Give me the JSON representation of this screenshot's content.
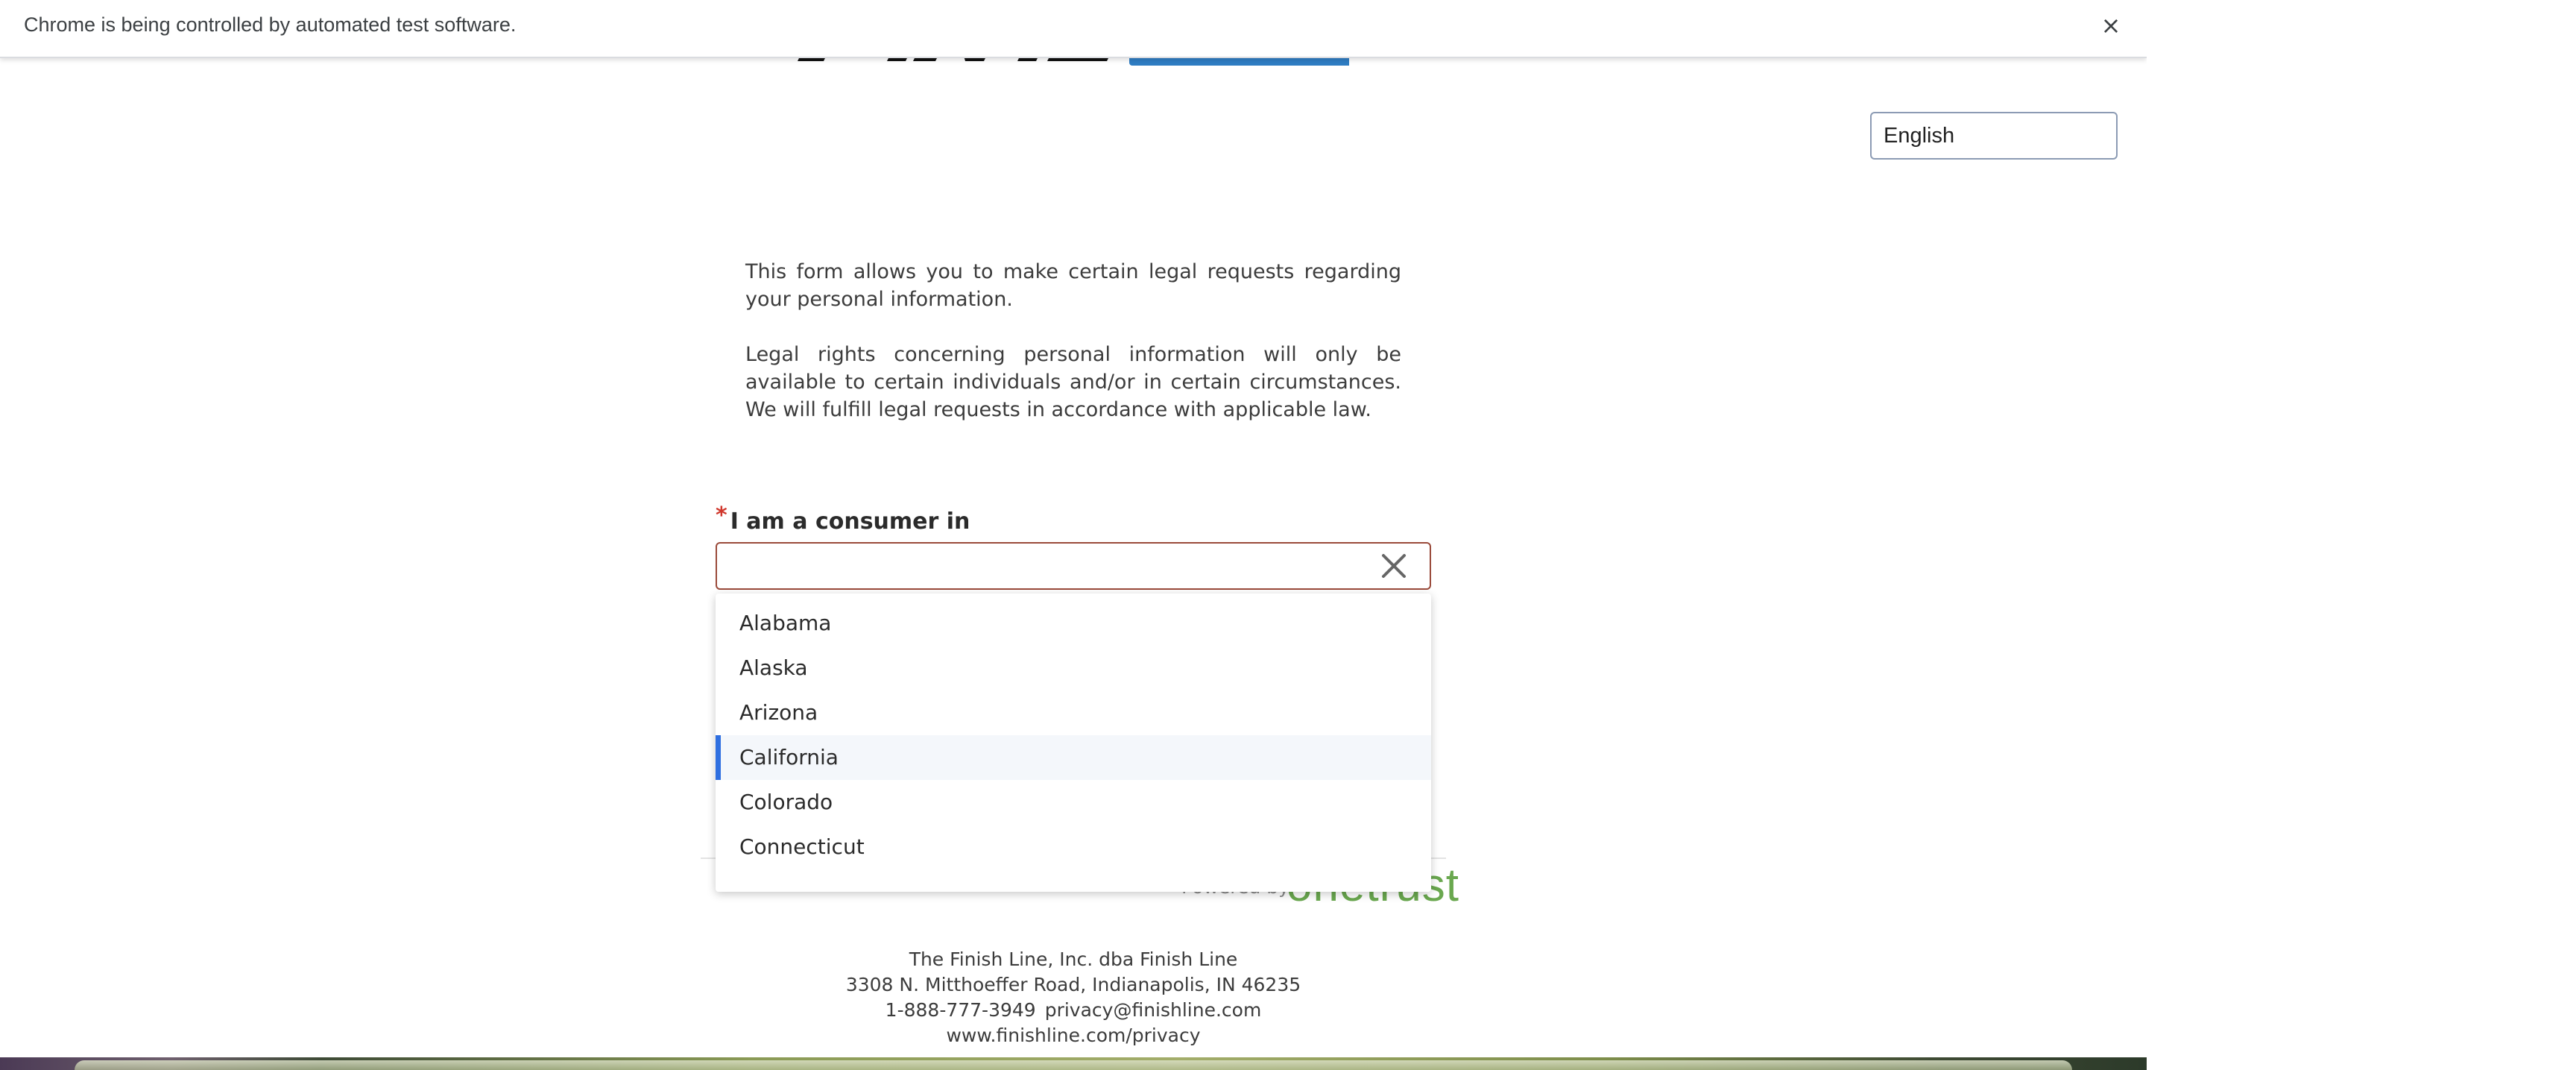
{
  "infobar": {
    "message": "Chrome is being controlled by automated test software.",
    "close_symbol": "×"
  },
  "colors": {
    "brand_blue": "#2f7dc3",
    "brand_black": "#111111",
    "onetrust_green": "#6aa84f",
    "required": "#d0372c",
    "active_indicator": "#2f6fe0"
  },
  "language": {
    "selected": "English"
  },
  "intro": {
    "paragraph_1": "This form allows you to make certain legal requests regarding your personal information.",
    "paragraph_2": "Legal rights concerning personal information will only be available to certain individuals and/or in certain circumstances. We will fulfill legal requests in accordance with applicable law."
  },
  "consumer_field": {
    "required_marker": "*",
    "label": "I am a consumer in",
    "value": "",
    "clear_icon": "close-icon"
  },
  "dropdown": {
    "options": [
      "Alabama",
      "Alaska",
      "Arizona",
      "California",
      "Colorado",
      "Connecticut"
    ],
    "highlighted": "California"
  },
  "powered_by": {
    "label": "Powered by",
    "brand": "onetrust"
  },
  "company": {
    "name": "The Finish Line, Inc. dba Finish Line",
    "address": "3308 N. Mitthoeffer Road, Indianapolis, IN 46235",
    "phone": "1-888-777-3949",
    "email": "privacy@finishline.com",
    "website": "www.finishline.com/privacy"
  }
}
